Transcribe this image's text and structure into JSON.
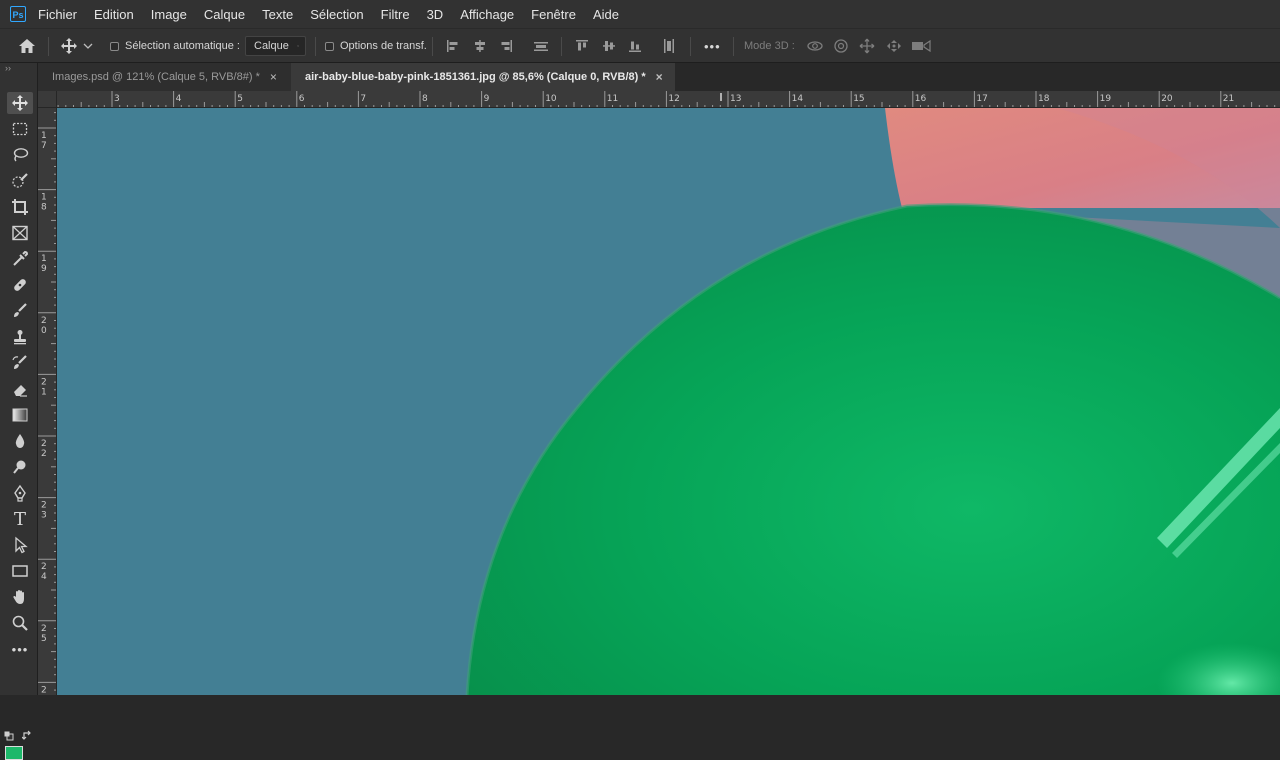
{
  "app": {
    "logo": "Ps"
  },
  "menu": [
    "Fichier",
    "Edition",
    "Image",
    "Calque",
    "Texte",
    "Sélection",
    "Filtre",
    "3D",
    "Affichage",
    "Fenêtre",
    "Aide"
  ],
  "options": {
    "auto_select_label": "Sélection automatique :",
    "auto_select_value": "Calque",
    "transform_label": "Options de transf.",
    "mode3d_label": "Mode 3D :",
    "more_label": "•••"
  },
  "tabs": [
    {
      "label": "Images.psd @ 121% (Calque 5, RVB/8#) *",
      "close": "×",
      "active": false
    },
    {
      "label": "air-baby-blue-baby-pink-1851361.jpg @ 85,6% (Calque 0, RVB/8) *",
      "close": "×",
      "active": true
    }
  ],
  "rulers": {
    "horizontal": [
      "3",
      "4",
      "5",
      "6",
      "7",
      "8",
      "9",
      "10",
      "11",
      "12",
      "13",
      "14",
      "15",
      "16",
      "17",
      "18",
      "19",
      "20",
      "21"
    ],
    "vertical": [
      "17",
      "18",
      "19",
      "20",
      "21",
      "22",
      "23",
      "24",
      "25",
      "2"
    ]
  },
  "toolbar": {
    "expand_glyph": "››",
    "more_tools": "•••",
    "tools": [
      "move-tool",
      "marquee-tool",
      "lasso-tool",
      "quick-selection-tool",
      "crop-tool",
      "frame-tool",
      "eyedropper-tool",
      "healing-brush-tool",
      "brush-tool",
      "clone-stamp-tool",
      "history-brush-tool",
      "eraser-tool",
      "gradient-tool",
      "blur-tool",
      "dodge-tool",
      "pen-tool",
      "type-tool",
      "path-selection-tool",
      "rectangle-tool",
      "hand-tool",
      "zoom-tool"
    ],
    "type_glyph": "T"
  },
  "colors": {
    "canvas_blue": "#437f94",
    "balloon_green": "#07a355",
    "balloon_pink": "#d98a86",
    "foreground_swatch": "#1db86a"
  }
}
